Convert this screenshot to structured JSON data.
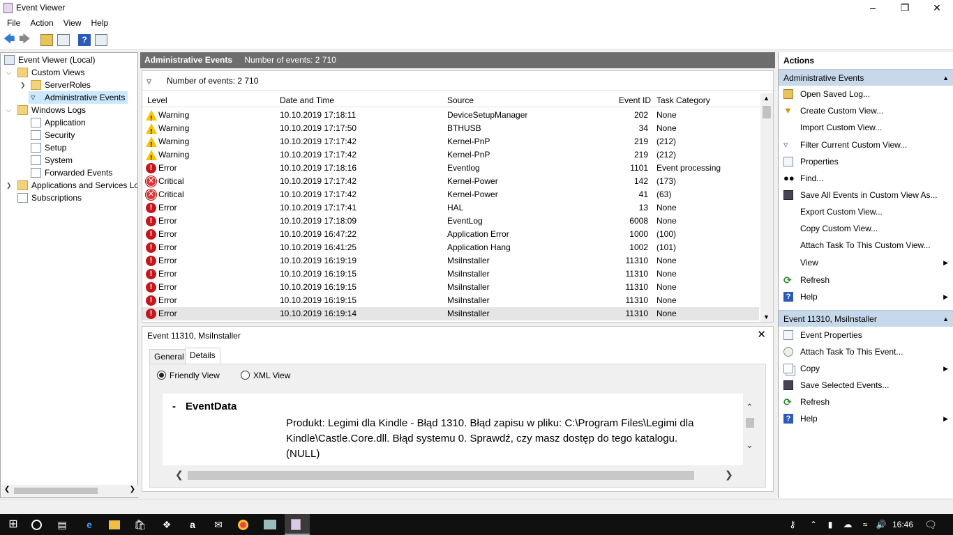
{
  "window": {
    "title": "Event Viewer",
    "minimize_icon": "minimize",
    "restore_icon": "restore",
    "close_icon": "close"
  },
  "menu": [
    "File",
    "Action",
    "View",
    "Help"
  ],
  "tree": {
    "root": "Event Viewer (Local)",
    "custom_views": "Custom Views",
    "server_roles": "ServerRoles",
    "admin_events": "Administrative Events",
    "windows_logs": "Windows Logs",
    "application": "Application",
    "security": "Security",
    "setup": "Setup",
    "system": "System",
    "forwarded": "Forwarded Events",
    "apps_services": "Applications and Services Lo",
    "subscriptions": "Subscriptions"
  },
  "center": {
    "header_title": "Administrative Events",
    "header_count": "Number of events: 2 710",
    "filter_count": "Number of events: 2 710",
    "columns": [
      "Level",
      "Date and Time",
      "Source",
      "Event ID",
      "Task Category"
    ],
    "rows": [
      {
        "level": "Warning",
        "type": "warning",
        "date": "10.10.2019 17:18:11",
        "source": "DeviceSetupManager",
        "id": "202",
        "task": "None"
      },
      {
        "level": "Warning",
        "type": "warning",
        "date": "10.10.2019 17:17:50",
        "source": "BTHUSB",
        "id": "34",
        "task": "None"
      },
      {
        "level": "Warning",
        "type": "warning",
        "date": "10.10.2019 17:17:42",
        "source": "Kernel-PnP",
        "id": "219",
        "task": "(212)"
      },
      {
        "level": "Warning",
        "type": "warning",
        "date": "10.10.2019 17:17:42",
        "source": "Kernel-PnP",
        "id": "219",
        "task": "(212)"
      },
      {
        "level": "Error",
        "type": "error",
        "date": "10.10.2019 17:18:16",
        "source": "Eventlog",
        "id": "1101",
        "task": "Event processing"
      },
      {
        "level": "Critical",
        "type": "critical",
        "date": "10.10.2019 17:17:42",
        "source": "Kernel-Power",
        "id": "142",
        "task": "(173)"
      },
      {
        "level": "Critical",
        "type": "critical",
        "date": "10.10.2019 17:17:42",
        "source": "Kernel-Power",
        "id": "41",
        "task": "(63)"
      },
      {
        "level": "Error",
        "type": "error",
        "date": "10.10.2019 17:17:41",
        "source": "HAL",
        "id": "13",
        "task": "None"
      },
      {
        "level": "Error",
        "type": "error",
        "date": "10.10.2019 17:18:09",
        "source": "EventLog",
        "id": "6008",
        "task": "None"
      },
      {
        "level": "Error",
        "type": "error",
        "date": "10.10.2019 16:47:22",
        "source": "Application Error",
        "id": "1000",
        "task": "(100)"
      },
      {
        "level": "Error",
        "type": "error",
        "date": "10.10.2019 16:41:25",
        "source": "Application Hang",
        "id": "1002",
        "task": "(101)"
      },
      {
        "level": "Error",
        "type": "error",
        "date": "10.10.2019 16:19:19",
        "source": "MsiInstaller",
        "id": "11310",
        "task": "None"
      },
      {
        "level": "Error",
        "type": "error",
        "date": "10.10.2019 16:19:15",
        "source": "MsiInstaller",
        "id": "11310",
        "task": "None"
      },
      {
        "level": "Error",
        "type": "error",
        "date": "10.10.2019 16:19:15",
        "source": "MsiInstaller",
        "id": "11310",
        "task": "None"
      },
      {
        "level": "Error",
        "type": "error",
        "date": "10.10.2019 16:19:15",
        "source": "MsiInstaller",
        "id": "11310",
        "task": "None"
      },
      {
        "level": "Error",
        "type": "error",
        "date": "10.10.2019 16:19:14",
        "source": "MsiInstaller",
        "id": "11310",
        "task": "None"
      }
    ]
  },
  "detail": {
    "title": "Event 11310, MsiInstaller",
    "tabs": [
      "General",
      "Details"
    ],
    "friendly": "Friendly View",
    "xml": "XML View",
    "section_dash": "-",
    "section_title": "EventData",
    "message_line1": "Produkt: Legimi dla Kindle - Błąd 1310. Błąd zapisu w pliku: C:\\Program Files\\Legimi dla",
    "message_line2": "Kindle\\Castle.Core.dll. Błąd systemu 0. Sprawdź, czy masz dostęp do tego katalogu.",
    "message_line3": "(NULL)"
  },
  "actions": {
    "header": "Actions",
    "section1": "Administrative Events",
    "items1": [
      {
        "label": "Open Saved Log...",
        "icon": "open-log",
        "arrow": false
      },
      {
        "label": "Create Custom View...",
        "icon": "filter-create",
        "arrow": false
      },
      {
        "label": "Import Custom View...",
        "icon": "none",
        "arrow": false
      },
      {
        "label": "Filter Current Custom View...",
        "icon": "filter",
        "arrow": false
      },
      {
        "label": "Properties",
        "icon": "properties",
        "arrow": false
      },
      {
        "label": "Find...",
        "icon": "binoculars",
        "arrow": false
      },
      {
        "label": "Save All Events in Custom View As...",
        "icon": "save",
        "arrow": false
      },
      {
        "label": "Export Custom View...",
        "icon": "none",
        "arrow": false
      },
      {
        "label": "Copy Custom View...",
        "icon": "none",
        "arrow": false
      },
      {
        "label": "Attach Task To This Custom View...",
        "icon": "none",
        "arrow": false
      },
      {
        "label": "View",
        "icon": "none",
        "arrow": true
      },
      {
        "label": "Refresh",
        "icon": "refresh",
        "arrow": false
      },
      {
        "label": "Help",
        "icon": "help",
        "arrow": true
      }
    ],
    "section2": "Event 11310, MsiInstaller",
    "items2": [
      {
        "label": "Event Properties",
        "icon": "properties",
        "arrow": false
      },
      {
        "label": "Attach Task To This Event...",
        "icon": "task",
        "arrow": false
      },
      {
        "label": "Copy",
        "icon": "copy",
        "arrow": true
      },
      {
        "label": "Save Selected Events...",
        "icon": "save",
        "arrow": false
      },
      {
        "label": "Refresh",
        "icon": "refresh",
        "arrow": false
      },
      {
        "label": "Help",
        "icon": "help",
        "arrow": true
      }
    ]
  },
  "taskbar": {
    "clock": "16:46"
  },
  "colors": {
    "warning": "#f7c600",
    "error": "#c4161c",
    "accent": "#c7d8ea",
    "header": "#6d6d6d"
  }
}
